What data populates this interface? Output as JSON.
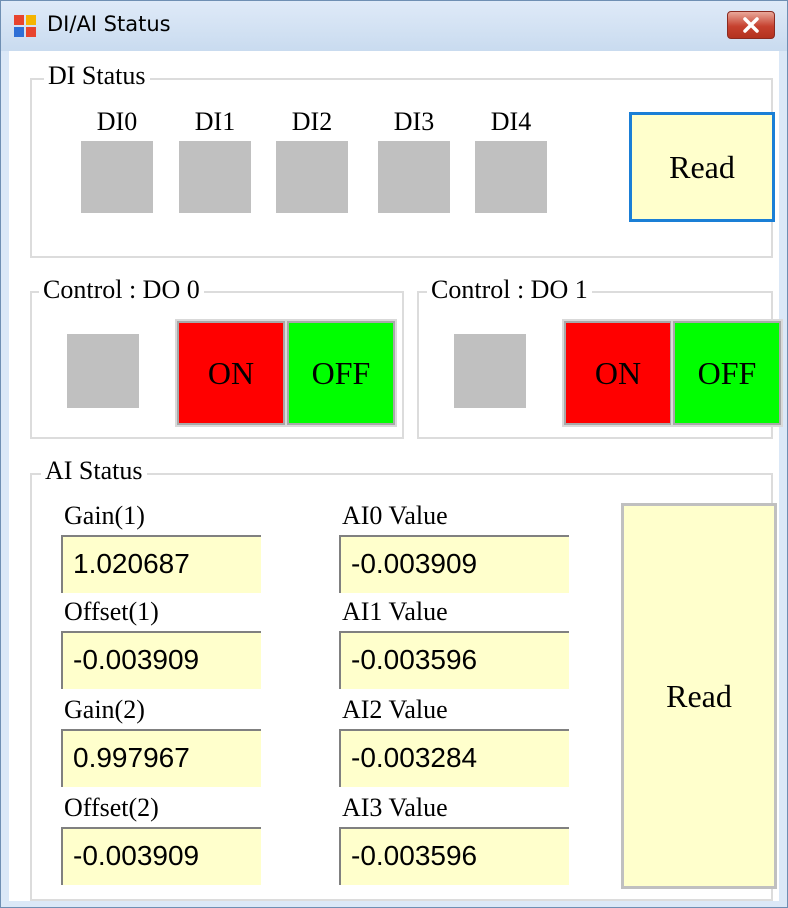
{
  "window": {
    "title": "DI/AI Status",
    "colors": {
      "titlebar": "#c9dbef",
      "close": "#c6412f"
    }
  },
  "di_status": {
    "legend": "DI Status",
    "channels": [
      "DI0",
      "DI1",
      "DI2",
      "DI3",
      "DI4"
    ],
    "indicator_color": "#c0c0c0",
    "read_label": "Read"
  },
  "controls": [
    {
      "legend": "Control : DO 0",
      "on_label": "ON",
      "off_label": "OFF"
    },
    {
      "legend": "Control : DO 1",
      "on_label": "ON",
      "off_label": "OFF"
    }
  ],
  "ai_status": {
    "legend": "AI Status",
    "left_fields": [
      {
        "label": "Gain(1)",
        "value": "1.020687"
      },
      {
        "label": "Offset(1)",
        "value": "-0.003909"
      },
      {
        "label": "Gain(2)",
        "value": "0.997967"
      },
      {
        "label": "Offset(2)",
        "value": "-0.003909"
      }
    ],
    "right_fields": [
      {
        "label": "AI0 Value",
        "value": "-0.003909"
      },
      {
        "label": "AI1 Value",
        "value": "-0.003596"
      },
      {
        "label": "AI2 Value",
        "value": "-0.003284"
      },
      {
        "label": "AI3 Value",
        "value": "-0.003596"
      }
    ],
    "read_label": "Read"
  },
  "colors": {
    "on": "#ff0000",
    "off": "#00ff00",
    "field_bg": "#ffffcc",
    "read_focus_border": "#1a7fd6"
  }
}
